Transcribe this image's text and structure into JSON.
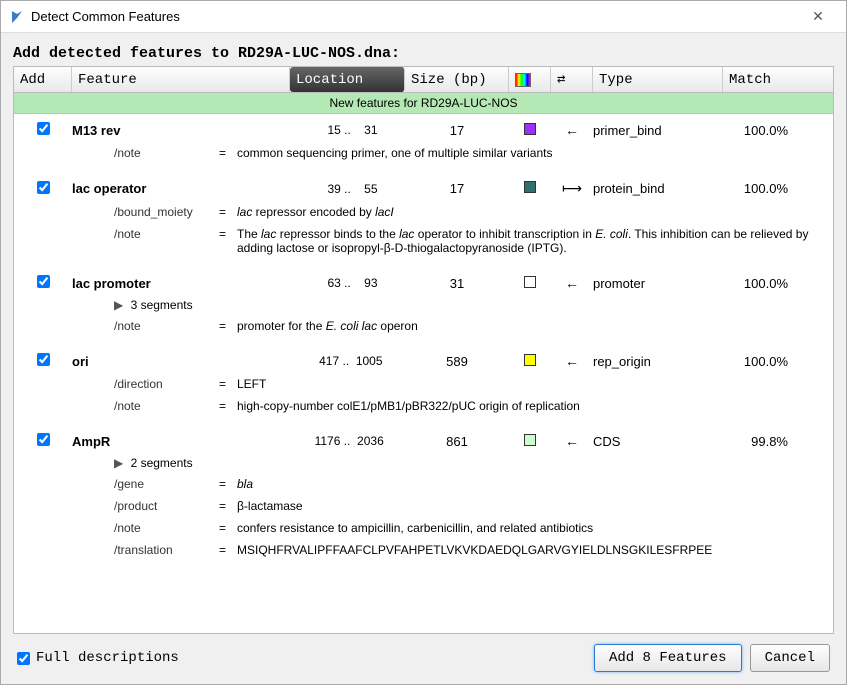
{
  "window": {
    "title": "Detect Common Features"
  },
  "subtitle": "Add detected features to RD29A-LUC-NOS.dna:",
  "columns": {
    "add": "Add",
    "feature": "Feature",
    "location": "Location",
    "size": "Size (bp)",
    "type": "Type",
    "match": "Match"
  },
  "group_header": "New features for RD29A-LUC-NOS",
  "features": [
    {
      "name": "M13 rev",
      "loc_from": "15",
      "loc_to": "31",
      "size": "17",
      "color": "#9b30ff",
      "dir": "←",
      "type": "primer_bind",
      "match": "100.0%",
      "details": [
        {
          "key": "/note",
          "val": "common sequencing primer, one of multiple similar variants"
        }
      ]
    },
    {
      "name": "lac operator",
      "loc_from": "39",
      "loc_to": "55",
      "size": "17",
      "color": "#2f6f6f",
      "dir": "⟼",
      "type": "protein_bind",
      "match": "100.0%",
      "details": [
        {
          "key": "/bound_moiety",
          "val_html": "<span class='italic'>lac</span> repressor encoded by <span class='italic'>lacI</span>"
        },
        {
          "key": "/note",
          "val_html": "The <span class='italic'>lac</span> repressor binds to the <span class='italic'>lac</span> operator to inhibit transcription in <span class='italic'>E. coli</span>. This inhibition can be relieved by adding lactose or isopropyl-β-D-thiogalactopyranoside (IPTG)."
        }
      ]
    },
    {
      "name": "lac promoter",
      "loc_from": "63",
      "loc_to": "93",
      "size": "31",
      "color": "#ffffff",
      "dir": "←",
      "type": "promoter",
      "match": "100.0%",
      "segments": "3 segments",
      "details": [
        {
          "key": "/note",
          "val_html": "promoter for the <span class='italic'>E. coli lac</span> operon"
        }
      ]
    },
    {
      "name": "ori",
      "loc_from": "417",
      "loc_to": "1005",
      "size": "589",
      "color": "#ffff00",
      "dir": "←",
      "type": "rep_origin",
      "match": "100.0%",
      "details": [
        {
          "key": "/direction",
          "val": "LEFT"
        },
        {
          "key": "/note",
          "val": "high-copy-number colE1/pMB1/pBR322/pUC origin of replication"
        }
      ]
    },
    {
      "name": "AmpR",
      "loc_from": "1176",
      "loc_to": "2036",
      "size": "861",
      "color": "#ccffcc",
      "dir": "←",
      "type": "CDS",
      "match": "99.8%",
      "segments": "2 segments",
      "details": [
        {
          "key": "/gene",
          "val_html": "<span class='italic'>bla</span>"
        },
        {
          "key": "/product",
          "val": "β-lactamase"
        },
        {
          "key": "/note",
          "val": "confers resistance to ampicillin, carbenicillin, and related antibiotics"
        },
        {
          "key": "/translation",
          "val": "MSIQHFRVALIPFFAAFCLPVFAHPETLVKVKDAEDQLGARVGYIELDLNSGKILESFRPEE"
        }
      ]
    }
  ],
  "footer": {
    "full_desc": "Full descriptions",
    "add_btn": "Add 8 Features",
    "cancel_btn": "Cancel"
  }
}
